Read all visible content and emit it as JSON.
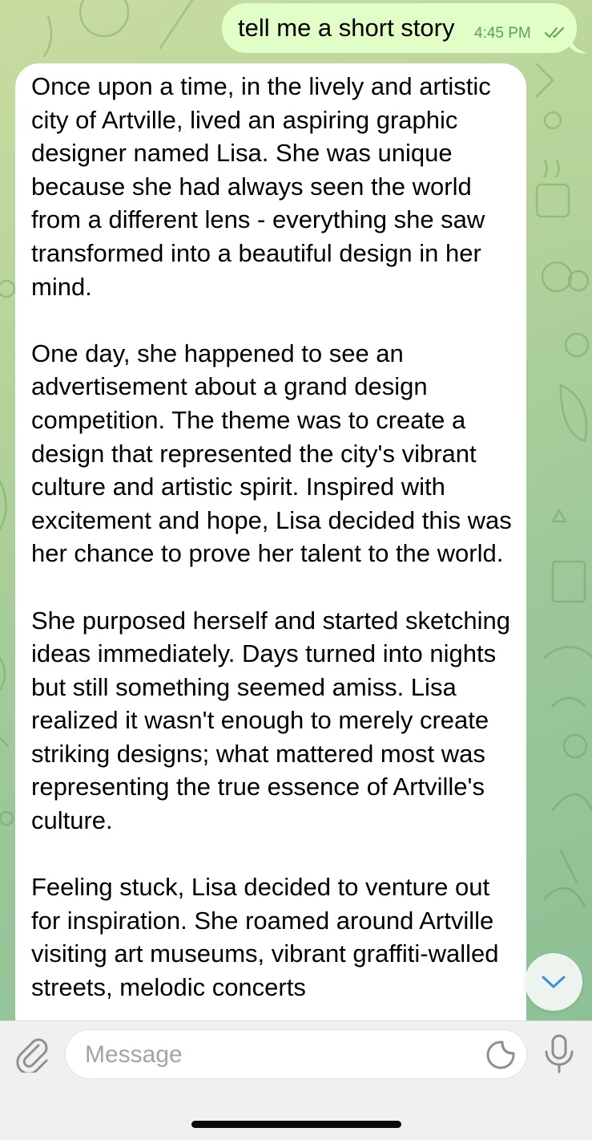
{
  "colors": {
    "outgoing_bubble": "#e1fec6",
    "incoming_bubble": "#ffffff",
    "timestamp_green": "#52a84c",
    "accent_blue": "#3b8fe0"
  },
  "outgoing": {
    "text": "tell me a short story",
    "time": "4:45 PM",
    "status_icon": "double-check-icon"
  },
  "incoming": {
    "paragraphs": [
      "Once upon a time, in the lively and artistic city of Artville, lived an aspiring graphic designer named Lisa. She was unique because she had always seen the world from a different lens - everything she saw transformed into a beautiful design in her mind.",
      "One day, she happened to see an advertisement about a grand design competition. The theme was to create a design that represented the city's vibrant culture and artistic spirit. Inspired with excitement and hope, Lisa decided this was her chance to prove her talent to the world.",
      "She purposed herself and started sketching ideas immediately. Days turned into nights but still something seemed amiss. Lisa realized it wasn't enough to merely create striking designs; what mattered most was representing the true essence of Artville's culture.",
      "Feeling stuck, Lisa decided to venture out for inspiration. She roamed around Artville visiting art museums, vibrant graffiti-walled streets, melodic concerts"
    ]
  },
  "input": {
    "placeholder": "Message"
  },
  "icons": {
    "attach": "paperclip-icon",
    "sticker": "sticker-icon",
    "mic": "microphone-icon",
    "scroll": "chevron-down-icon"
  }
}
